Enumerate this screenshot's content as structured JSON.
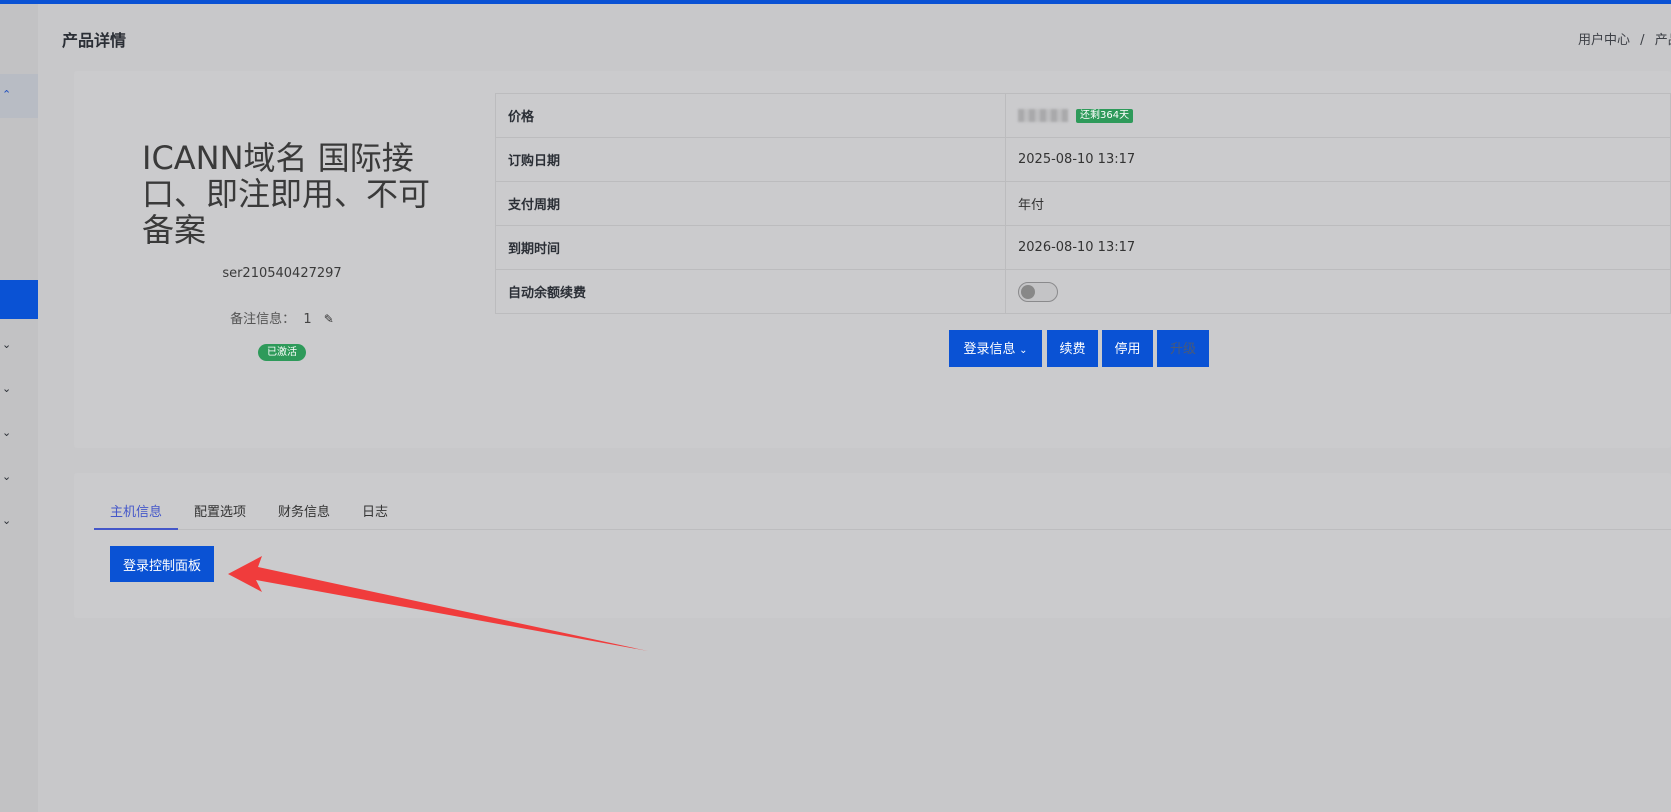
{
  "header": {
    "page_title": "产品详情",
    "breadcrumb": [
      "用户中心",
      "/",
      "产品"
    ]
  },
  "product": {
    "name": "ICANN域名 国际接口、即注即用、不可备案",
    "service_id": "ser210540427297",
    "note_label": "备注信息：",
    "note_value": "1",
    "status": "已激活"
  },
  "details": {
    "rows": [
      {
        "label": "价格",
        "value": "",
        "badge": "还剩364天"
      },
      {
        "label": "订购日期",
        "value": "2025-08-10 13:17"
      },
      {
        "label": "支付周期",
        "value": "年付"
      },
      {
        "label": "到期时间",
        "value": "2026-08-10 13:17"
      },
      {
        "label": "自动余额续费",
        "value": ""
      }
    ],
    "auto_renew_on": false
  },
  "actions": {
    "login_info": "登录信息",
    "renew": "续费",
    "stop": "停用",
    "upgrade": "升级"
  },
  "tabs": [
    "主机信息",
    "配置选项",
    "财务信息",
    "日志"
  ],
  "active_tab": 0,
  "panel": {
    "login_panel": "登录控制面板"
  },
  "icons": {
    "edit": "pencil-icon",
    "dropdown": "chevron-down-icon",
    "arrow": "red-arrow-annotation"
  },
  "colors": {
    "primary": "#0a52d4",
    "success": "#2e9a5a",
    "annotation": "#f03c3c"
  }
}
